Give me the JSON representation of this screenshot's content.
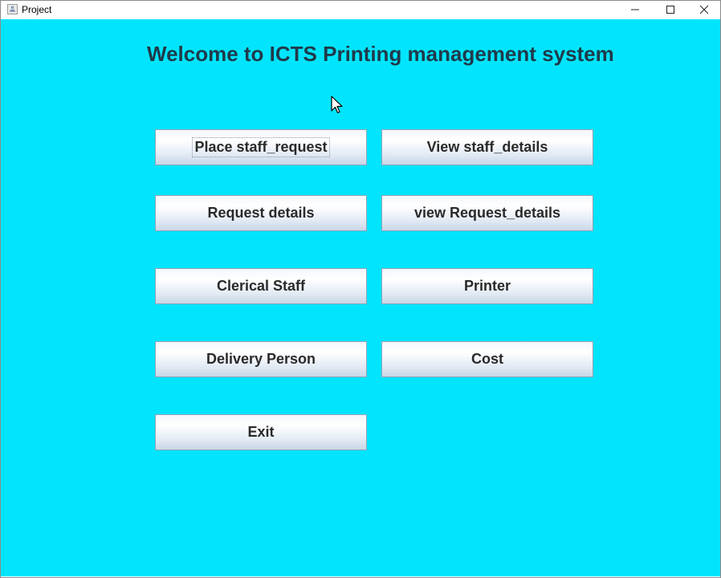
{
  "window": {
    "title": "Project"
  },
  "titlebar_icons": {
    "app": "java-app-icon",
    "minimize": "minimize-icon",
    "maximize": "maximize-icon",
    "close": "close-icon"
  },
  "main": {
    "heading": "Welcome to ICTS Printing management system",
    "background_color": "#00e5fd",
    "buttons": {
      "place_staff_request": "Place staff_request",
      "view_staff_details": "View staff_details",
      "request_details": "Request details",
      "view_request_details": "view Request_details",
      "clerical_staff": "Clerical Staff",
      "printer": "Printer",
      "delivery_person": "Delivery Person",
      "cost": "Cost",
      "exit": "Exit"
    },
    "focused_button": "Place staff_request"
  },
  "cursor_icon": "mouse-pointer-icon"
}
